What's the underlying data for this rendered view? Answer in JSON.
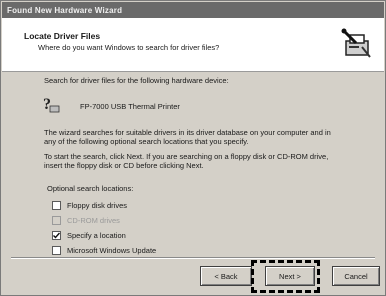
{
  "window": {
    "title": "Found New Hardware Wizard"
  },
  "header": {
    "title": "Locate Driver Files",
    "subtitle": "Where do you want Windows to search for driver files?",
    "icon": "wizard-icon"
  },
  "content": {
    "search_intro": "Search for driver files for the following hardware device:",
    "device_name": "FP-7000 USB Thermal Printer",
    "device_icon": "hardware-question-icon",
    "paragraph1_line1": "The wizard searches for suitable drivers in its driver database on your computer and in",
    "paragraph1_line2": "any of the following optional search locations that you specify.",
    "paragraph2_line1": "To start the search, click Next. If you are searching on a floppy disk or CD-ROM drive,",
    "paragraph2_line2": "insert the floppy disk or CD before clicking Next.",
    "optional_label": "Optional search locations:",
    "options": [
      {
        "label": "Floppy disk drives",
        "checked": false,
        "enabled": true
      },
      {
        "label": "CD-ROM drives",
        "checked": false,
        "enabled": false
      },
      {
        "label": "Specify a location",
        "checked": true,
        "enabled": true
      },
      {
        "label": "Microsoft Windows Update",
        "checked": false,
        "enabled": true
      }
    ]
  },
  "buttons": {
    "back": "< Back",
    "next": "Next >",
    "cancel": "Cancel"
  }
}
